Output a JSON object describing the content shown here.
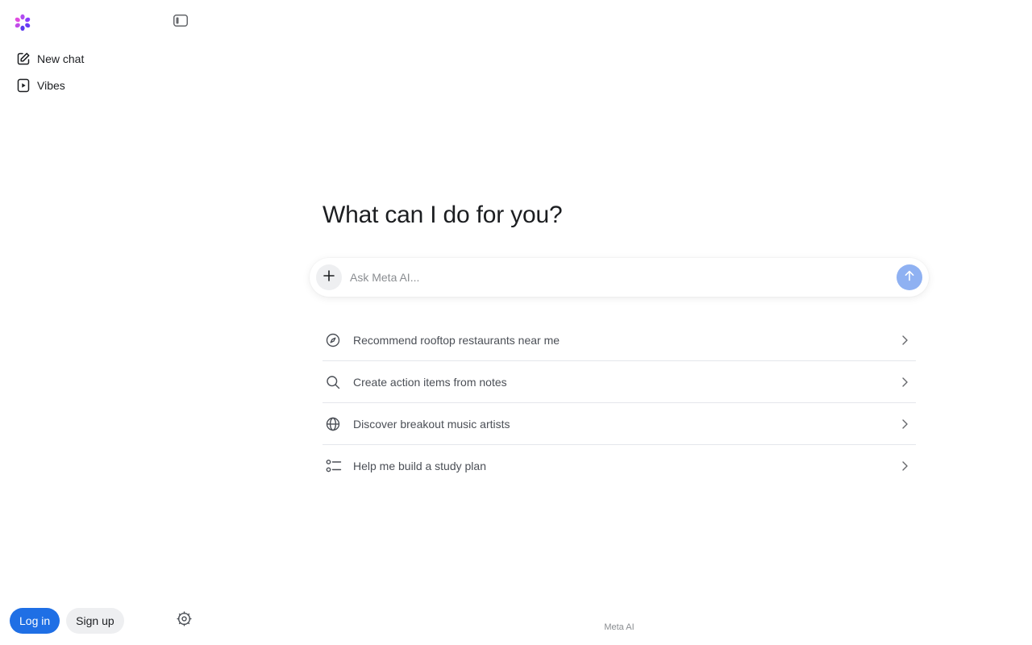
{
  "sidebar": {
    "logo_icon": "meta-ai-logo",
    "collapse_icon": "sidebar-toggle-icon",
    "items": [
      {
        "label": "New chat",
        "icon": "edit-icon"
      },
      {
        "label": "Vibes",
        "icon": "play-icon"
      }
    ],
    "login_label": "Log in",
    "signup_label": "Sign up",
    "settings_icon": "gear-icon"
  },
  "main": {
    "headline": "What can I do for you?",
    "composer": {
      "placeholder": "Ask Meta AI...",
      "value": "",
      "add_icon": "plus-icon",
      "send_icon": "arrow-up-icon"
    },
    "suggestions": [
      {
        "label": "Recommend rooftop restaurants near me",
        "icon": "compass-icon"
      },
      {
        "label": "Create action items from notes",
        "icon": "search-icon"
      },
      {
        "label": "Discover breakout music artists",
        "icon": "globe-icon"
      },
      {
        "label": "Help me build a study plan",
        "icon": "list-icon"
      }
    ]
  },
  "footer": {
    "label": "Meta AI"
  },
  "colors": {
    "accent": "#1f6fe5",
    "send_button": "#8fb1f2",
    "logo_purple": "#8b3dff",
    "logo_pink": "#e04ce0"
  }
}
